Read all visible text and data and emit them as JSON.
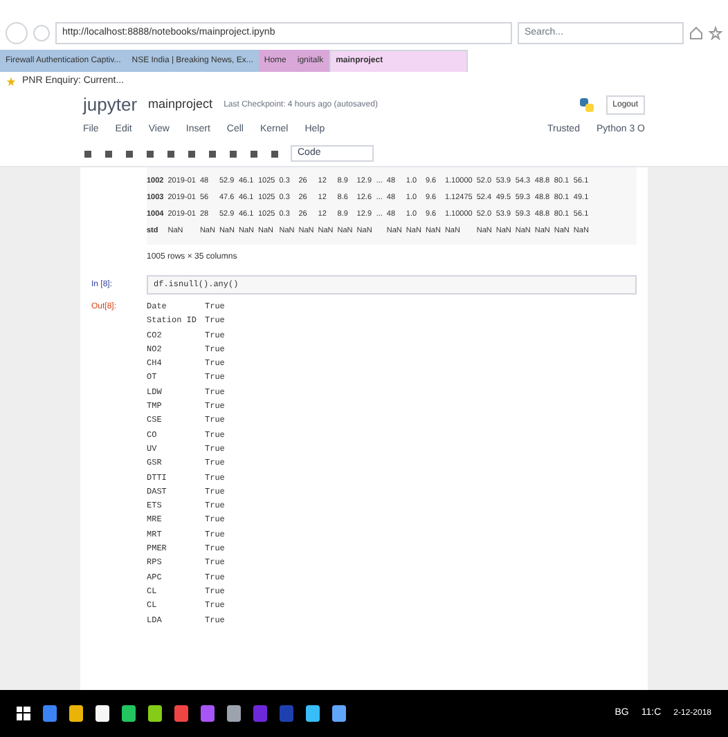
{
  "browser": {
    "address": "http://localhost:8888/notebooks/mainproject.ipynb",
    "search_placeholder": "Search...",
    "tabs": [
      {
        "label": "Firewall Authentication Captiv...",
        "selected": false,
        "color": "#a9c4e0"
      },
      {
        "label": "NSE India | Breaking News, Ex...",
        "selected": false,
        "color": "#a9c4e0"
      },
      {
        "label": "Home",
        "selected": false,
        "color": "#d9a8d9"
      },
      {
        "label": "ignitalk",
        "selected": false,
        "color": "#d9a8d9"
      },
      {
        "label": "mainproject",
        "selected": true,
        "color": "#f3d6f3"
      }
    ],
    "favorites": [
      "PNR Enquiry: Current..."
    ]
  },
  "jupyter": {
    "logo": "jupyter",
    "notebook": "mainproject",
    "checkpoint": "Last Checkpoint: 4 hours ago (autosaved)",
    "logout": "Logout",
    "menu": [
      "File",
      "Edit",
      "View",
      "Insert",
      "Cell",
      "Kernel",
      "Help"
    ],
    "trusted": "Trusted",
    "kernel": "Python 3 O",
    "cell_type": "Code"
  },
  "table": {
    "rows": [
      [
        "1002",
        "2019-01",
        "48",
        "52.9",
        "46.1",
        "1025",
        "0.3",
        "26",
        "12",
        "8.9",
        "12.9",
        "...",
        "48",
        "1.0",
        "9.6",
        "1.10000",
        "52.0",
        "53.9",
        "54.3",
        "48.8",
        "80.1",
        "56.1"
      ],
      [
        "1003",
        "2019-01",
        "56",
        "47.6",
        "46.1",
        "1025",
        "0.3",
        "26",
        "12",
        "8.6",
        "12.6",
        "...",
        "48",
        "1.0",
        "9.6",
        "1.12475",
        "52.4",
        "49.5",
        "59.3",
        "48.8",
        "80.1",
        "49.1"
      ],
      [
        "1004",
        "2019-01",
        "28",
        "52.9",
        "46.1",
        "1025",
        "0.3",
        "26",
        "12",
        "8.9",
        "12.9",
        "...",
        "48",
        "1.0",
        "9.6",
        "1.10000",
        "52.0",
        "53.9",
        "59.3",
        "48.8",
        "80.1",
        "56.1"
      ],
      [
        "std",
        "NaN",
        "NaN",
        "NaN",
        "NaN",
        "NaN",
        "NaN",
        "NaN",
        "NaN",
        "NaN",
        "NaN",
        "",
        "NaN",
        "NaN",
        "NaN",
        "NaN",
        "NaN",
        "NaN",
        "NaN",
        "NaN",
        "NaN",
        "NaN"
      ]
    ],
    "shape": "1005 rows × 35 columns"
  },
  "cell": {
    "prompt": "In [8]:",
    "code": "df.isnull().any()"
  },
  "output": {
    "prompt": "Out[8]:",
    "rows": [
      [
        "Date",
        "True"
      ],
      [
        "Station ID",
        "True"
      ],
      [
        "CO2",
        "True"
      ],
      [
        "NO2",
        "True"
      ],
      [
        "CH4",
        "True"
      ],
      [
        "OT",
        "True"
      ],
      [
        "LDW",
        "True"
      ],
      [
        "TMP",
        "True"
      ],
      [
        "CSE",
        "True"
      ],
      [
        "CO",
        "True"
      ],
      [
        "UV",
        "True"
      ],
      [
        "GSR",
        "True"
      ],
      [
        "DTTI",
        "True"
      ],
      [
        "DAST",
        "True"
      ],
      [
        "ETS",
        "True"
      ],
      [
        "MRE",
        "True"
      ],
      [
        "MRT",
        "True"
      ],
      [
        "PMER",
        "True"
      ],
      [
        "RPS",
        "True"
      ],
      [
        "APC",
        "True"
      ],
      [
        "CL",
        "True"
      ],
      [
        "CL",
        "True"
      ],
      [
        "LDA",
        "True"
      ]
    ]
  },
  "taskbar": {
    "tray": [
      "BG",
      "11:C"
    ],
    "date": "2-12-2018"
  }
}
